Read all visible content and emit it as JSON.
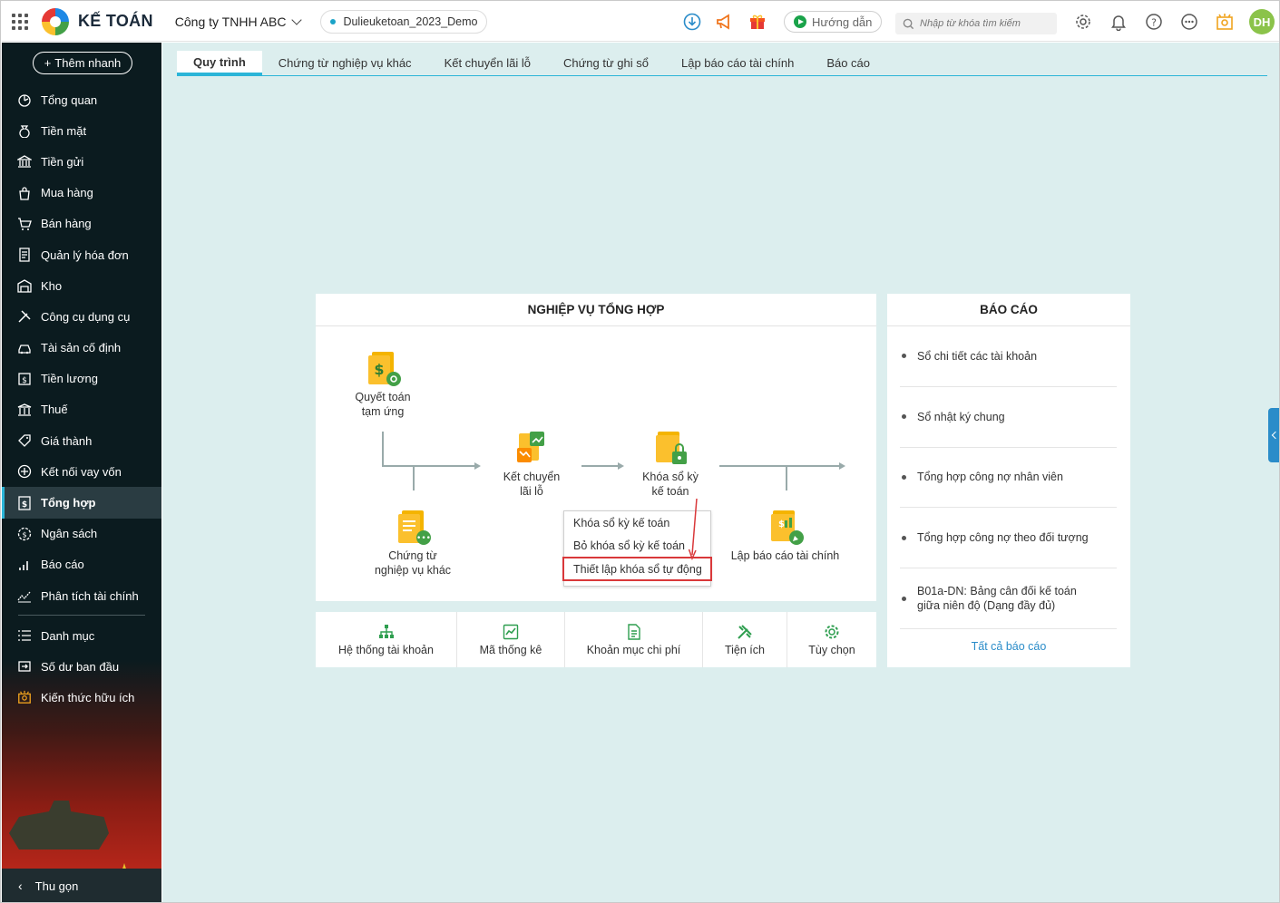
{
  "header": {
    "brand": "KẾ TOÁN",
    "company": "Công ty TNHH ABC",
    "database": "Dulieuketoan_2023_Demo",
    "guide_label": "Hướng dẫn",
    "search_placeholder": "Nhập từ khóa tìm kiếm",
    "avatar_initials": "DH",
    "avatar_color": "#8bc34a"
  },
  "sidebar": {
    "quick_add": "Thêm nhanh",
    "items": [
      {
        "label": "Tổng quan",
        "icon": "dashboard-icon"
      },
      {
        "label": "Tiền mặt",
        "icon": "money-bag-icon"
      },
      {
        "label": "Tiền gửi",
        "icon": "bank-icon"
      },
      {
        "label": "Mua hàng",
        "icon": "shopping-bag-icon"
      },
      {
        "label": "Bán hàng",
        "icon": "cart-icon"
      },
      {
        "label": "Quản lý hóa đơn",
        "icon": "invoice-icon"
      },
      {
        "label": "Kho",
        "icon": "warehouse-icon"
      },
      {
        "label": "Công cụ dụng cụ",
        "icon": "tools-icon"
      },
      {
        "label": "Tài sản cố định",
        "icon": "car-icon"
      },
      {
        "label": "Tiền lương",
        "icon": "salary-icon"
      },
      {
        "label": "Thuế",
        "icon": "tax-icon"
      },
      {
        "label": "Giá thành",
        "icon": "price-tag-icon"
      },
      {
        "label": "Kết nối vay vốn",
        "icon": "loan-icon"
      },
      {
        "label": "Tổng hợp",
        "icon": "summary-icon"
      },
      {
        "label": "Ngân sách",
        "icon": "budget-icon"
      },
      {
        "label": "Báo cáo",
        "icon": "bar-chart-icon"
      },
      {
        "label": "Phân tích tài chính",
        "icon": "analytics-icon"
      }
    ],
    "items2": [
      {
        "label": "Danh mục",
        "icon": "list-icon"
      },
      {
        "label": "Số dư ban đầu",
        "icon": "opening-balance-icon"
      },
      {
        "label": "Kiến thức hữu ích",
        "icon": "knowledge-icon"
      }
    ],
    "active_item": "Tổng hợp",
    "collapse_label": "Thu gọn"
  },
  "tabs": [
    "Quy trình",
    "Chứng từ nghiệp vụ khác",
    "Kết chuyển lãi lỗ",
    "Chứng từ ghi sổ",
    "Lập báo cáo tài chính",
    "Báo cáo"
  ],
  "active_tab": "Quy trình",
  "process": {
    "title": "NGHIỆP VỤ TỔNG HỢP",
    "nodes": {
      "advance": "Quyết toán tạm ứng",
      "other_vouchers": "Chứng từ nghiệp vụ khác",
      "profit_loss": "Kết chuyển lãi lỗ",
      "lock_period": "Khóa sổ kỳ kế toán",
      "financial_report": "Lập báo cáo tài chính"
    },
    "popup": [
      "Khóa sổ kỳ kế toán",
      "Bỏ khóa sổ kỳ kế toán",
      "Thiết lập khóa sổ tự động"
    ]
  },
  "toolbar": [
    "Hệ thống tài khoản",
    "Mã thống kê",
    "Khoản mục chi phí",
    "Tiện ích",
    "Tùy chọn"
  ],
  "reports": {
    "title": "BÁO CÁO",
    "items": [
      "Sổ chi tiết các tài khoản",
      "Sổ nhật ký chung",
      "Tổng hợp công nợ nhân viên",
      "Tổng hợp công nợ theo đối tượng",
      "B01a-DN: Bảng cân đối kế toán giữa niên độ (Dạng đầy đủ)"
    ],
    "all_label": "Tất cả báo cáo"
  }
}
